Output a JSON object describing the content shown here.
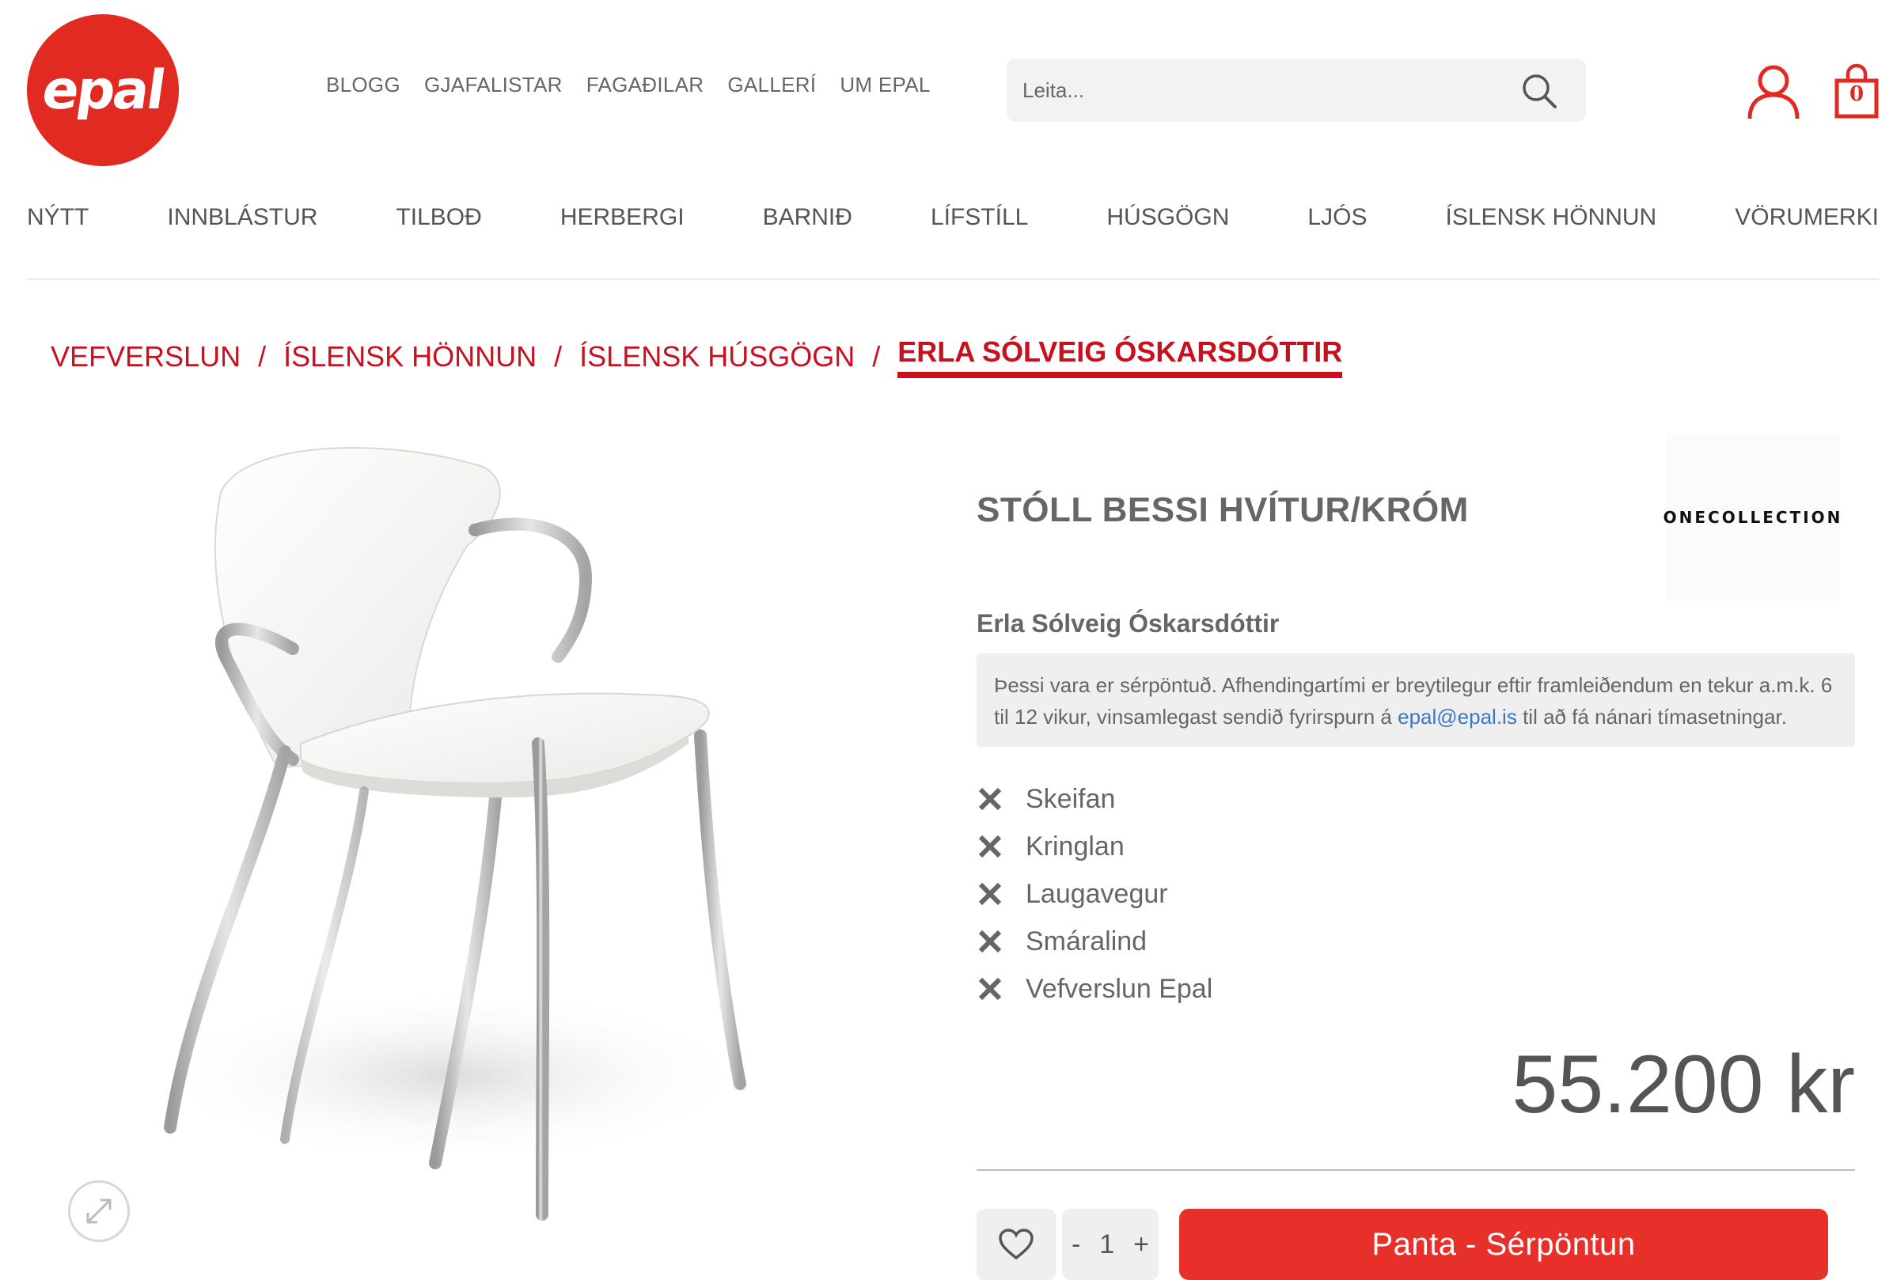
{
  "brand": {
    "logo_text": "epal"
  },
  "top_nav": [
    "BLOGG",
    "GJAFALISTAR",
    "FAGAÐILAR",
    "GALLERÍ",
    "UM EPAL"
  ],
  "search": {
    "placeholder": "Leita..."
  },
  "cart": {
    "count": "0"
  },
  "main_nav": [
    "NÝTT",
    "INNBLÁSTUR",
    "TILBOÐ",
    "HERBERGI",
    "BARNIÐ",
    "LÍFSTÍLL",
    "HÚSGÖGN",
    "LJÓS",
    "ÍSLENSK HÖNNUN",
    "VÖRUMERKI"
  ],
  "breadcrumb": [
    "VEFVERSLUN",
    "ÍSLENSK HÖNNUN",
    "ÍSLENSK HÚSGÖGN",
    "ERLA SÓLVEIG ÓSKARSDÓTTIR"
  ],
  "product": {
    "title": "STÓLL BESSI HVÍTUR/KRÓM",
    "brand_logo": "ONECOLLECTION",
    "designer": "Erla Sólveig Óskarsdóttir",
    "notice_pre": "Þessi vara er sérpöntuð. Afhendingartími er breytilegur eftir framleiðendum en tekur a.m.k. 6 til 12 vikur, vinsamlegast sendið fyrirspurn á ",
    "notice_email": "epal@epal.is",
    "notice_post": " til að fá nánari tímasetningar.",
    "stores": [
      "Skeifan",
      "Kringlan",
      "Laugavegur",
      "Smáralind",
      "Vefverslun Epal"
    ],
    "price": "55.200 kr",
    "quantity": "1",
    "qty_minus": "-",
    "qty_plus": "+",
    "order_button": "Panta - Sérpöntun"
  },
  "colors": {
    "brand_red": "#e02a22",
    "breadcrumb_red": "#c8101f",
    "button_red": "#e8302a",
    "link_blue": "#3a78c2"
  }
}
